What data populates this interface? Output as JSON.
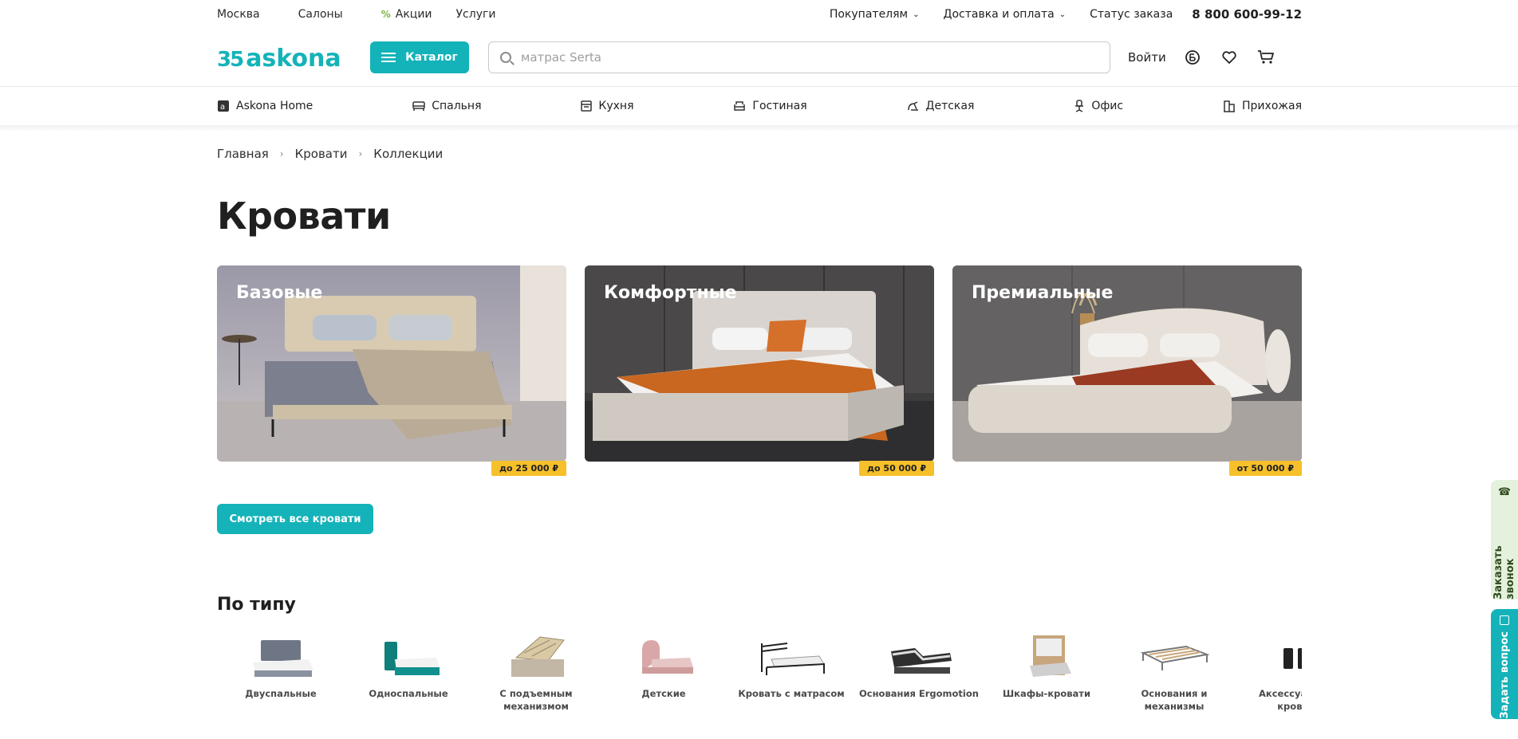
{
  "topbar": {
    "city": "Москва",
    "salons": "Салоны",
    "promo": "Акции",
    "services": "Услуги",
    "buyers": "Покупателям",
    "delivery": "Доставка и оплата",
    "order_status": "Статус заказа",
    "phone": "8 800 600-99-12"
  },
  "header": {
    "logo_number": "35",
    "logo_name": "askona",
    "catalog_label": "Каталог",
    "search_placeholder": "матрас Serta",
    "login_label": "Войти",
    "icons": [
      "bonus-icon",
      "heart-icon",
      "cart-icon"
    ]
  },
  "catnav": [
    {
      "label": "Askona Home",
      "icon": "askona-home-icon"
    },
    {
      "label": "Спальня",
      "icon": "bed-icon"
    },
    {
      "label": "Кухня",
      "icon": "kitchen-icon"
    },
    {
      "label": "Гостиная",
      "icon": "sofa-icon"
    },
    {
      "label": "Детская",
      "icon": "kids-icon"
    },
    {
      "label": "Офис",
      "icon": "office-chair-icon"
    },
    {
      "label": "Прихожая",
      "icon": "hallway-icon"
    }
  ],
  "breadcrumbs": [
    "Главная",
    "Кровати",
    "Коллекции"
  ],
  "page_title": "Кровати",
  "collections": [
    {
      "title": "Базовые",
      "price": "до 25 000 ₽"
    },
    {
      "title": "Комфортные",
      "price": "до 50 000 ₽"
    },
    {
      "title": "Премиальные",
      "price": "от 50 000 ₽"
    }
  ],
  "all_beds_button": "Смотреть все кровати",
  "by_type_title": "По типу",
  "types": [
    "Двуспальные",
    "Односпальные",
    "С подъемным механизмом",
    "Детские",
    "Кровать с матрасом",
    "Основания Ergomotion",
    "Шкафы-кровати",
    "Основания и механизмы",
    "Аксессуары для кроватей"
  ],
  "side": {
    "callback": "Заказать звонок",
    "question": "Задать вопрос"
  },
  "colors": {
    "accent": "#14b3b9",
    "price_badge": "#f6c02b",
    "callback_bg": "#e4f1dc"
  }
}
